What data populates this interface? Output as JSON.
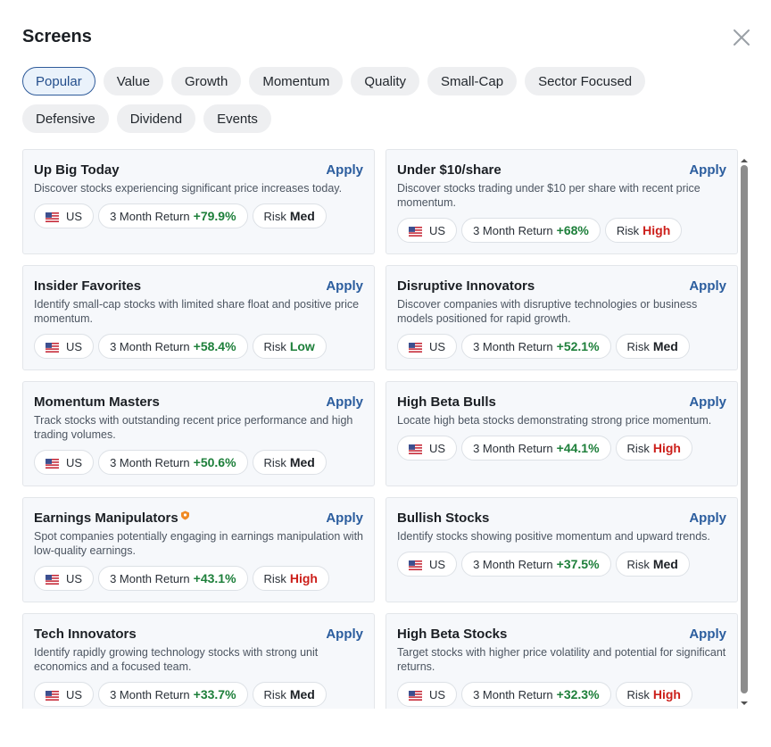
{
  "header": {
    "title": "Screens",
    "close_icon": "close-icon"
  },
  "filters": [
    {
      "label": "Popular",
      "active": true
    },
    {
      "label": "Value",
      "active": false
    },
    {
      "label": "Growth",
      "active": false
    },
    {
      "label": "Momentum",
      "active": false
    },
    {
      "label": "Quality",
      "active": false
    },
    {
      "label": "Small-Cap",
      "active": false
    },
    {
      "label": "Sector Focused",
      "active": false
    },
    {
      "label": "Defensive",
      "active": false
    },
    {
      "label": "Dividend",
      "active": false
    },
    {
      "label": "Events",
      "active": false
    }
  ],
  "apply_label": "Apply",
  "return_label": "3 Month Return",
  "risk_label": "Risk",
  "colors": {
    "accent": "#2b5d9e",
    "positive": "#1d7f3a",
    "high_risk": "#cc1f1a",
    "badge": "#f08a24"
  },
  "screens": [
    {
      "title": "Up Big Today",
      "description": "Discover stocks experiencing significant price increases today.",
      "region": "US",
      "return": "+79.9%",
      "risk": "Med",
      "risk_color": "dark",
      "badge": false
    },
    {
      "title": "Under $10/share",
      "description": "Discover stocks trading under $10 per share with recent price momentum.",
      "region": "US",
      "return": "+68%",
      "risk": "High",
      "risk_color": "red",
      "badge": false
    },
    {
      "title": "Insider Favorites",
      "description": "Identify small-cap stocks with limited share float and positive price momentum.",
      "region": "US",
      "return": "+58.4%",
      "risk": "Low",
      "risk_color": "green",
      "badge": false
    },
    {
      "title": "Disruptive Innovators",
      "description": "Discover companies with disruptive technologies or business models positioned for rapid growth.",
      "region": "US",
      "return": "+52.1%",
      "risk": "Med",
      "risk_color": "dark",
      "badge": false
    },
    {
      "title": "Momentum Masters",
      "description": "Track stocks with outstanding recent price performance and high trading volumes.",
      "region": "US",
      "return": "+50.6%",
      "risk": "Med",
      "risk_color": "dark",
      "badge": false
    },
    {
      "title": "High Beta Bulls",
      "description": "Locate high beta stocks demonstrating strong price momentum.",
      "region": "US",
      "return": "+44.1%",
      "risk": "High",
      "risk_color": "red",
      "badge": false
    },
    {
      "title": "Earnings Manipulators",
      "description": "Spot companies potentially engaging in earnings manipulation with low-quality earnings.",
      "region": "US",
      "return": "+43.1%",
      "risk": "High",
      "risk_color": "red",
      "badge": true
    },
    {
      "title": "Bullish Stocks",
      "description": "Identify stocks showing positive momentum and upward trends.",
      "region": "US",
      "return": "+37.5%",
      "risk": "Med",
      "risk_color": "dark",
      "badge": false
    },
    {
      "title": "Tech Innovators",
      "description": "Identify rapidly growing technology stocks with strong unit economics and a focused team.",
      "region": "US",
      "return": "+33.7%",
      "risk": "Med",
      "risk_color": "dark",
      "badge": false
    },
    {
      "title": "High Beta Stocks",
      "description": "Target stocks with higher price volatility and potential for significant returns.",
      "region": "US",
      "return": "+32.3%",
      "risk": "High",
      "risk_color": "red",
      "badge": false
    }
  ]
}
